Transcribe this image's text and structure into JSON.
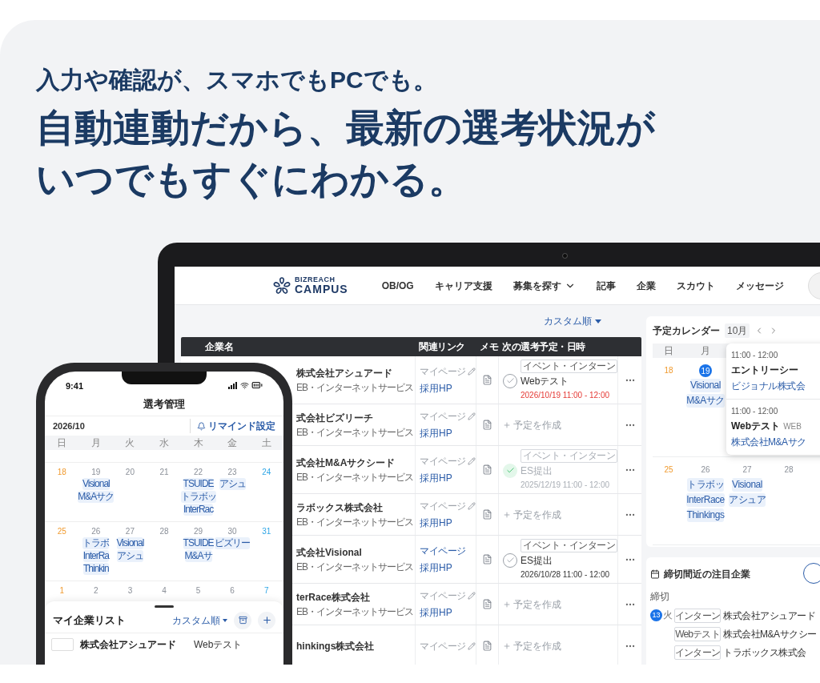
{
  "headline": {
    "lead": "入力や確認が、スマホでもPCでも。",
    "title_lines": [
      "自動連動だから、最新の選考状況が",
      "いつでもすぐにわかる。"
    ]
  },
  "laptop": {
    "nav": {
      "logo_small": "BIZREACH",
      "logo": "CAMPUS",
      "items": [
        {
          "label": "OB/OG",
          "dropdown": false
        },
        {
          "label": "キャリア支援",
          "dropdown": false
        },
        {
          "label": "募集を探す",
          "dropdown": true
        },
        {
          "label": "記事",
          "dropdown": false
        },
        {
          "label": "企業",
          "dropdown": false
        },
        {
          "label": "スカウト",
          "dropdown": false
        },
        {
          "label": "メッセージ",
          "dropdown": false
        }
      ]
    },
    "sort_label": "カスタム順",
    "table": {
      "columns": [
        "企業名",
        "関連リンク",
        "メモ",
        "次の選考予定・日時"
      ],
      "rows": [
        {
          "company": "株式会社アシュアード",
          "industry": "EB・インターネットサービス",
          "mypage": "マイページ",
          "mypage_active": false,
          "hp": "採用HP",
          "schedule": {
            "kind": "event",
            "tag": "イベント・インターン",
            "title": "Webテスト",
            "datetime": "2026/10/19 11:00 - 12:00",
            "done": false,
            "highlight": true
          }
        },
        {
          "company": "式会社ビズリーチ",
          "industry": "EB・インターネットサービス",
          "mypage": "マイページ",
          "mypage_active": false,
          "hp": "採用HP",
          "schedule": {
            "kind": "create",
            "label": "予定を作成"
          }
        },
        {
          "company": "式会社M&Aサクシード",
          "industry": "EB・インターネットサービス",
          "mypage": "マイページ",
          "mypage_active": false,
          "hp": "採用HP",
          "schedule": {
            "kind": "event",
            "tag": "イベント・インターン",
            "title": "ES提出",
            "datetime": "2025/12/19 11:00 - 12:00",
            "done": true,
            "highlight": false
          }
        },
        {
          "company": "ラボックス株式会社",
          "industry": "EB・インターネットサービス",
          "mypage": "マイページ",
          "mypage_active": false,
          "hp": "採用HP",
          "schedule": {
            "kind": "create",
            "label": "予定を作成"
          }
        },
        {
          "company": "式会社Visional",
          "industry": "EB・インターネットサービス",
          "mypage": "マイページ",
          "mypage_active": true,
          "hp": "採用HP",
          "schedule": {
            "kind": "event",
            "tag": "イベント・インターン",
            "title": "ES提出",
            "datetime": "2026/10/28 11:00 - 12:00",
            "done": false,
            "highlight": false
          }
        },
        {
          "company": "terRace株式会社",
          "industry": "EB・インターネットサービス",
          "mypage": "マイページ",
          "mypage_active": false,
          "hp": "採用HP",
          "schedule": {
            "kind": "create",
            "label": "予定を作成"
          }
        },
        {
          "company": "hinkings株式会社",
          "mypage": "マイページ",
          "mypage_active": false,
          "schedule": {
            "kind": "create",
            "label": "予定を作成"
          }
        }
      ]
    },
    "calendar": {
      "title": "予定カレンダー",
      "month": "10月",
      "weekdays": [
        "日",
        "月"
      ],
      "weeks": [
        {
          "days": [
            {
              "day": "18",
              "kind": "sunday",
              "today": false
            },
            {
              "day": "19",
              "today": true,
              "events": [
                "Visional",
                "M&Aサク"
              ]
            }
          ]
        },
        {
          "days": [
            {
              "day": "25",
              "kind": "sunday",
              "today": false
            },
            {
              "day": "26",
              "kind": "weekday",
              "today": false,
              "events": [
                "トラボッ",
                "InterRace",
                "Thinkings"
              ]
            },
            {
              "day": "27",
              "kind": "weekday",
              "today": false,
              "events": [
                "Visional",
                "アシュア"
              ]
            },
            {
              "day": "28",
              "kind": "weekday",
              "today": false
            }
          ]
        }
      ],
      "popup": [
        {
          "time": "11:00 - 12:00",
          "title": "エントリーシー",
          "company": "ビジョナル株式会"
        },
        {
          "time": "11:00 - 12:00",
          "title": "Webテスト",
          "tag": "WEB",
          "company": "株式会社M&Aサク"
        }
      ]
    },
    "deadlines": {
      "title": "締切間近の注目企業",
      "label": "締切",
      "day": "13",
      "weekday": "火",
      "items": [
        {
          "tag": "インターン",
          "company": "株式会社アシュアード"
        },
        {
          "tag": "Webテスト",
          "company": "株式会社M&Aサクシー"
        },
        {
          "tag": "インターン",
          "company": "トラボックス株式会"
        }
      ]
    }
  },
  "phone": {
    "time": "9:41",
    "title": "選考管理",
    "month": "2026/10",
    "remind": "リマインド設定",
    "weekdays": [
      "日",
      "月",
      "火",
      "水",
      "木",
      "金",
      "土"
    ],
    "weeks": [
      {
        "days": [
          {
            "day": "18",
            "kind": "sunday"
          },
          {
            "day": "19",
            "kind": "weekday",
            "events": [
              "Visional",
              "M&Aサク"
            ]
          },
          {
            "day": "20",
            "kind": "weekday"
          },
          {
            "day": "21",
            "kind": "weekday"
          },
          {
            "day": "22",
            "kind": "weekday",
            "events": [
              "TSUIDE",
              "トラボッ",
              "InterRac"
            ]
          },
          {
            "day": "23",
            "kind": "weekday",
            "events": [
              "アシュ"
            ]
          },
          {
            "day": "24",
            "kind": "saturday"
          }
        ]
      },
      {
        "days": [
          {
            "day": "25",
            "kind": "sunday"
          },
          {
            "day": "26",
            "kind": "weekday",
            "events": [
              "トラボ",
              "InterRa",
              "Thinkin"
            ]
          },
          {
            "day": "27",
            "kind": "weekday",
            "events": [
              "Visional",
              "アシュ"
            ]
          },
          {
            "day": "28",
            "kind": "weekday"
          },
          {
            "day": "29",
            "kind": "weekday",
            "events": [
              "TSUIDE",
              "M&Aサ"
            ]
          },
          {
            "day": "30",
            "kind": "weekday",
            "events": [
              "ビズリー"
            ]
          },
          {
            "day": "31",
            "kind": "saturday"
          }
        ]
      },
      {
        "days": [
          {
            "day": "1",
            "kind": "sunday"
          },
          {
            "day": "2",
            "kind": "weekday"
          },
          {
            "day": "3",
            "kind": "weekday"
          },
          {
            "day": "4",
            "kind": "weekday"
          },
          {
            "day": "5",
            "kind": "weekday"
          },
          {
            "day": "6",
            "kind": "weekday"
          },
          {
            "day": "7",
            "kind": "saturday"
          }
        ]
      }
    ],
    "sheet": {
      "title": "マイ企業リスト",
      "sort": "カスタム順",
      "rows": [
        {
          "company": "株式会社アシュアード",
          "status": "Webテスト"
        }
      ]
    }
  }
}
